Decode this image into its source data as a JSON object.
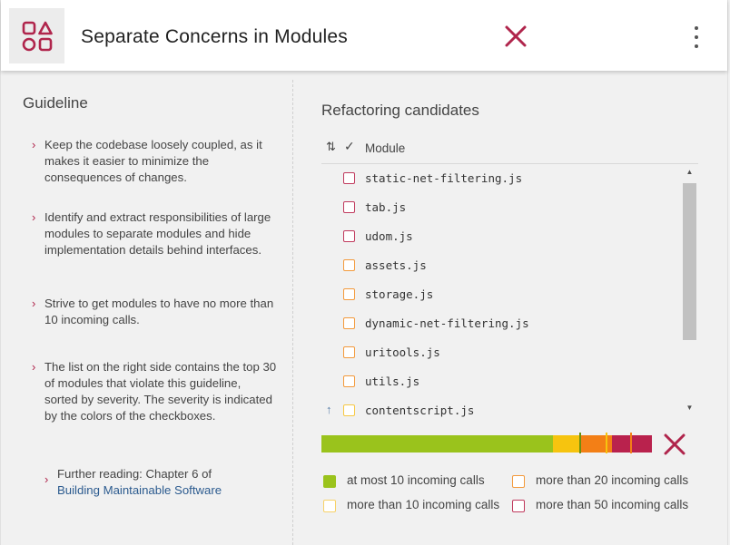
{
  "header": {
    "title": "Separate Concerns in Modules",
    "logo_icon": "modules-grid-icon",
    "close_icon": "close-icon",
    "menu_icon": "kebab-menu-icon",
    "accent_color": "#b0254c"
  },
  "guideline": {
    "heading": "Guideline",
    "items": [
      "Keep the codebase loosely coupled, as it makes it easier to minimize the consequences of changes.",
      "Identify and extract responsibilities of large modules to separate modules and hide implementation details behind interfaces.",
      "Strive to get modules to have no more than 10 incoming calls.",
      "The list on the right side contains the top 30 of modules that violate this guideline, sorted by severity. The severity is indicated by the colors of the checkboxes."
    ],
    "further_reading_prefix": "Further reading: Chapter 6 of",
    "further_reading_link": "Building Maintainable Software"
  },
  "candidates": {
    "heading": "Refactoring candidates",
    "column_label": "Module",
    "rows": [
      {
        "name": "static-net-filtering.js",
        "color": "#c0395d"
      },
      {
        "name": "tab.js",
        "color": "#c0395d"
      },
      {
        "name": "udom.js",
        "color": "#c0395d"
      },
      {
        "name": "assets.js",
        "color": "#f39a3c"
      },
      {
        "name": "storage.js",
        "color": "#f39a3c"
      },
      {
        "name": "dynamic-net-filtering.js",
        "color": "#f39a3c"
      },
      {
        "name": "uritools.js",
        "color": "#f39a3c"
      },
      {
        "name": "utils.js",
        "color": "#f39a3c"
      },
      {
        "name": "contentscript.js",
        "color": "#f7c843"
      }
    ]
  },
  "severity_bar": {
    "segments": [
      {
        "fraction": 0.7,
        "color": "#9ac31c"
      },
      {
        "fraction": 0.08,
        "color": "#f6c40f"
      },
      {
        "fraction": 0.1,
        "color": "#f37f16"
      },
      {
        "fraction": 0.12,
        "color": "#b9224d"
      }
    ]
  },
  "legend": {
    "items": [
      {
        "label": "at most 10 incoming calls",
        "color": "#9ac31c",
        "filled": true
      },
      {
        "label": "more than 20 incoming calls",
        "color": "#f39a3c",
        "filled": false
      },
      {
        "label": "more than 10 incoming calls",
        "color": "#f7d268",
        "filled": false
      },
      {
        "label": "more than 50 incoming calls",
        "color": "#c0395d",
        "filled": false
      }
    ]
  }
}
